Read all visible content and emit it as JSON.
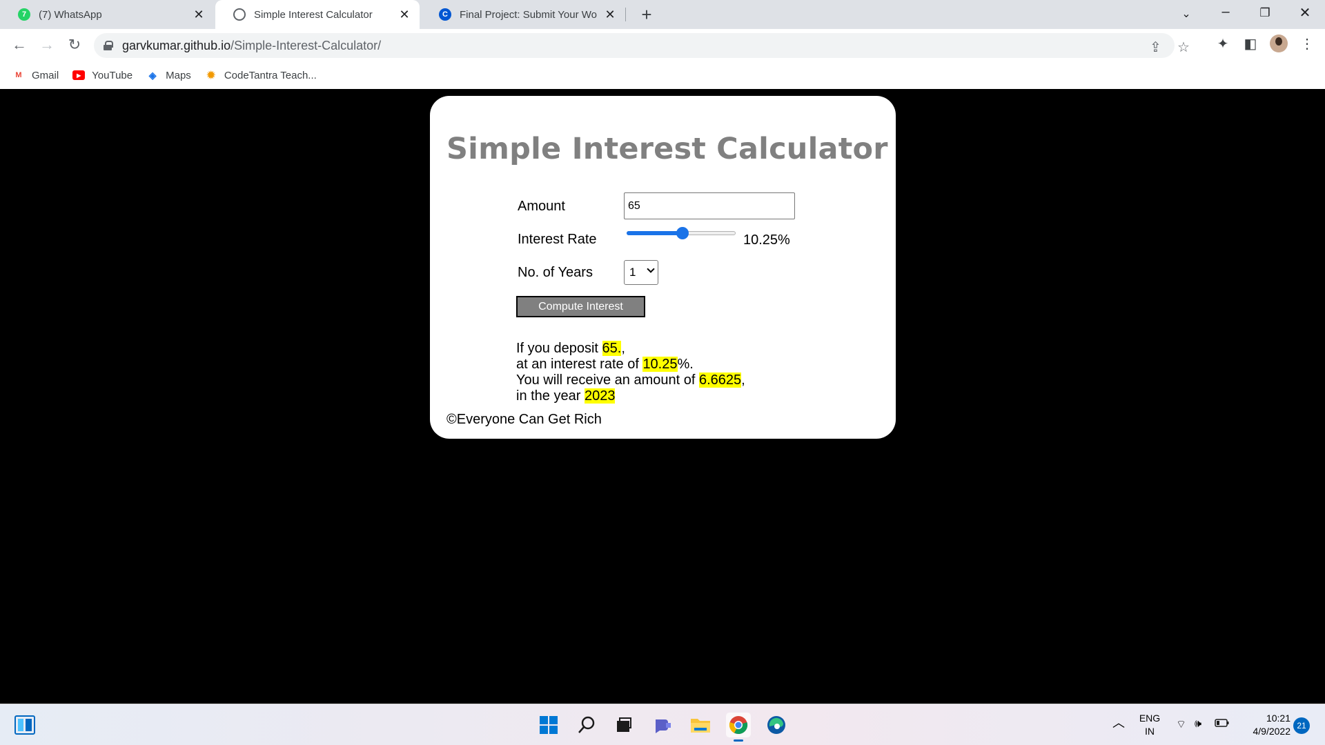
{
  "browser": {
    "tabs": [
      {
        "title": "(7) WhatsApp",
        "favicon": "whatsapp-icon",
        "color": "#25d366",
        "glyph": "7"
      },
      {
        "title": "Simple Interest Calculator",
        "favicon": "globe-icon",
        "color": "#5f6368",
        "glyph": ""
      },
      {
        "title": "Final Project: Submit Your Work a",
        "favicon": "coursera-icon",
        "color": "#0056d2",
        "glyph": "C"
      }
    ],
    "url_host": "garvkumar.github.io",
    "url_path": "/Simple-Interest-Calculator/",
    "bookmarks": [
      {
        "label": "Gmail",
        "icon": "gmail-icon"
      },
      {
        "label": "YouTube",
        "icon": "youtube-icon"
      },
      {
        "label": "Maps",
        "icon": "maps-icon"
      },
      {
        "label": "CodeTantra Teach...",
        "icon": "codetantra-icon"
      }
    ]
  },
  "page": {
    "title": "Simple Interest Calculator",
    "amount_label": "Amount",
    "amount_value": "65",
    "rate_label": "Interest Rate",
    "rate_value": "10.25%",
    "rate_fraction": 0.512,
    "years_label": "No. of Years",
    "years_value": "1",
    "compute_label": "Compute Interest",
    "result": {
      "line1_prefix": "If you deposit ",
      "deposit": "65.",
      "line1_suffix": ",",
      "line2_prefix": "at an interest rate of ",
      "rate": "10.25",
      "line2_suffix": "%.",
      "line3_prefix": "You will receive an amount of ",
      "amount": "6.6625",
      "line3_suffix": ",",
      "line4_prefix": "in the year ",
      "year": "2023"
    },
    "footer": "©Everyone Can Get Rich"
  },
  "taskbar": {
    "lang_top": "ENG",
    "lang_bottom": "IN",
    "time": "10:21",
    "date": "4/9/2022",
    "notifications": "21"
  }
}
